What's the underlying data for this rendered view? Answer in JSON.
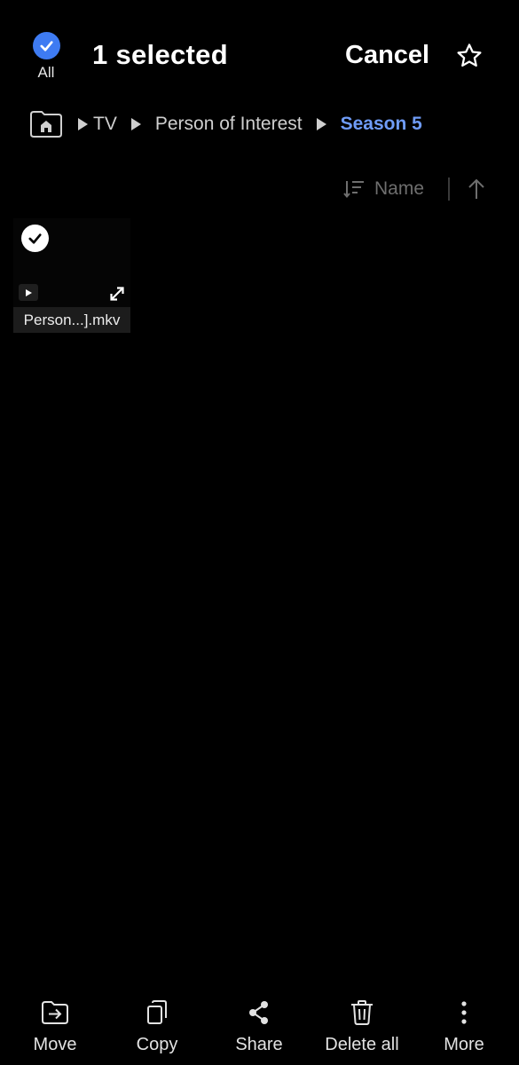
{
  "header": {
    "select_all_label": "All",
    "selected_title": "1 selected",
    "cancel_label": "Cancel"
  },
  "breadcrumb": {
    "items": [
      "TV",
      "Person of Interest"
    ],
    "current": "Season 5"
  },
  "sort": {
    "label": "Name",
    "direction": "ascending"
  },
  "files": [
    {
      "name": "Person...].mkv",
      "type": "video",
      "selected": true
    }
  ],
  "actions": [
    {
      "label": "Move",
      "icon": "move-to-folder-icon"
    },
    {
      "label": "Copy",
      "icon": "copy-icon"
    },
    {
      "label": "Share",
      "icon": "share-icon"
    },
    {
      "label": "Delete all",
      "icon": "trash-icon"
    },
    {
      "label": "More",
      "icon": "more-vertical-icon"
    }
  ],
  "colors": {
    "accent": "#3e7bf2",
    "breadcrumb_current": "#6f9cf7",
    "background": "#000000"
  }
}
